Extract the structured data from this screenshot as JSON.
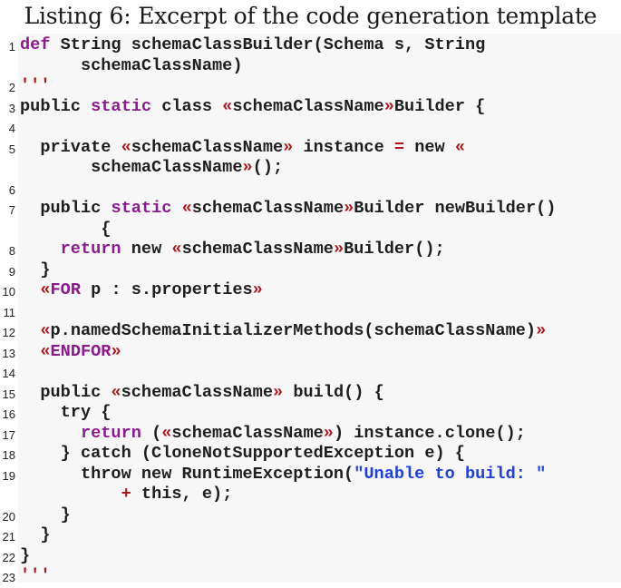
{
  "caption": "Listing 6: Excerpt of the code generation template",
  "colors": {
    "background": "#ffffff",
    "code_background": "#f7f7f7",
    "plain_text": "#1e1e1e",
    "keyword": "#8b1a8e",
    "template_delimiter": "#b0141c",
    "operator": "#b0141c",
    "string_literal": "#1f3fe0"
  },
  "listing": {
    "lines": [
      {
        "number": "1",
        "segments": [
          {
            "t": "def",
            "c": "kw"
          },
          {
            "t": " String schemaClassBuilder(Schema s, String",
            "c": ""
          }
        ],
        "continuation": [
          {
            "t": "      schemaClassName)",
            "c": ""
          }
        ]
      },
      {
        "number": "2",
        "segments": [
          {
            "t": "'''",
            "c": "q"
          }
        ]
      },
      {
        "number": "3",
        "segments": [
          {
            "t": "public ",
            "c": ""
          },
          {
            "t": "static",
            "c": "kw"
          },
          {
            "t": " class ",
            "c": ""
          },
          {
            "t": "«",
            "c": "gl"
          },
          {
            "t": "schemaClassName",
            "c": ""
          },
          {
            "t": "»",
            "c": "gl"
          },
          {
            "t": "Builder {",
            "c": ""
          }
        ]
      },
      {
        "number": "4",
        "segments": []
      },
      {
        "number": "5",
        "segments": [
          {
            "t": "  private ",
            "c": ""
          },
          {
            "t": "«",
            "c": "gl"
          },
          {
            "t": "schemaClassName",
            "c": ""
          },
          {
            "t": "»",
            "c": "gl"
          },
          {
            "t": " instance ",
            "c": ""
          },
          {
            "t": "=",
            "c": "op"
          },
          {
            "t": " new ",
            "c": ""
          },
          {
            "t": "«",
            "c": "gl"
          }
        ],
        "continuation": [
          {
            "t": "       schemaClassName",
            "c": ""
          },
          {
            "t": "»",
            "c": "gl"
          },
          {
            "t": "();",
            "c": ""
          }
        ]
      },
      {
        "number": "6",
        "segments": []
      },
      {
        "number": "7",
        "segments": [
          {
            "t": "  public ",
            "c": ""
          },
          {
            "t": "static",
            "c": "kw"
          },
          {
            "t": " ",
            "c": ""
          },
          {
            "t": "«",
            "c": "gl"
          },
          {
            "t": "schemaClassName",
            "c": ""
          },
          {
            "t": "»",
            "c": "gl"
          },
          {
            "t": "Builder newBuilder()",
            "c": ""
          }
        ],
        "continuation": [
          {
            "t": "        {",
            "c": ""
          }
        ]
      },
      {
        "number": "8",
        "segments": [
          {
            "t": "    ",
            "c": ""
          },
          {
            "t": "return",
            "c": "kw"
          },
          {
            "t": " new ",
            "c": ""
          },
          {
            "t": "«",
            "c": "gl"
          },
          {
            "t": "schemaClassName",
            "c": ""
          },
          {
            "t": "»",
            "c": "gl"
          },
          {
            "t": "Builder();",
            "c": ""
          }
        ]
      },
      {
        "number": "9",
        "segments": [
          {
            "t": "  }",
            "c": ""
          }
        ]
      },
      {
        "number": "10",
        "segments": [
          {
            "t": "  ",
            "c": ""
          },
          {
            "t": "«",
            "c": "gl"
          },
          {
            "t": "FOR",
            "c": "tpl"
          },
          {
            "t": " p : s.properties",
            "c": ""
          },
          {
            "t": "»",
            "c": "gl"
          }
        ]
      },
      {
        "number": "11",
        "segments": []
      },
      {
        "number": "12",
        "segments": [
          {
            "t": "  ",
            "c": ""
          },
          {
            "t": "«",
            "c": "gl"
          },
          {
            "t": "p.namedSchemaInitializerMethods(schemaClassName)",
            "c": ""
          },
          {
            "t": "»",
            "c": "gl"
          }
        ]
      },
      {
        "number": "13",
        "segments": [
          {
            "t": "  ",
            "c": ""
          },
          {
            "t": "«",
            "c": "gl"
          },
          {
            "t": "ENDFOR",
            "c": "tpl"
          },
          {
            "t": "»",
            "c": "gl"
          }
        ]
      },
      {
        "number": "14",
        "segments": []
      },
      {
        "number": "15",
        "segments": [
          {
            "t": "  public ",
            "c": ""
          },
          {
            "t": "«",
            "c": "gl"
          },
          {
            "t": "schemaClassName",
            "c": ""
          },
          {
            "t": "»",
            "c": "gl"
          },
          {
            "t": " build() {",
            "c": ""
          }
        ]
      },
      {
        "number": "16",
        "segments": [
          {
            "t": "    try {",
            "c": ""
          }
        ]
      },
      {
        "number": "17",
        "segments": [
          {
            "t": "      ",
            "c": ""
          },
          {
            "t": "return",
            "c": "kw"
          },
          {
            "t": " (",
            "c": ""
          },
          {
            "t": "«",
            "c": "gl"
          },
          {
            "t": "schemaClassName",
            "c": ""
          },
          {
            "t": "»",
            "c": "gl"
          },
          {
            "t": ") instance.clone();",
            "c": ""
          }
        ]
      },
      {
        "number": "18",
        "segments": [
          {
            "t": "    } catch (CloneNotSupportedException e) {",
            "c": ""
          }
        ]
      },
      {
        "number": "19",
        "segments": [
          {
            "t": "      throw new RuntimeException(",
            "c": ""
          },
          {
            "t": "\"Unable to build: \"",
            "c": "str"
          }
        ],
        "continuation": [
          {
            "t": "          ",
            "c": ""
          },
          {
            "t": "+",
            "c": "op"
          },
          {
            "t": " this, e);",
            "c": ""
          }
        ]
      },
      {
        "number": "20",
        "segments": [
          {
            "t": "    }",
            "c": ""
          }
        ]
      },
      {
        "number": "21",
        "segments": [
          {
            "t": "  }",
            "c": ""
          }
        ]
      },
      {
        "number": "22",
        "segments": [
          {
            "t": "}",
            "c": ""
          }
        ]
      },
      {
        "number": "23",
        "segments": [
          {
            "t": "'''",
            "c": "q"
          }
        ]
      }
    ]
  }
}
